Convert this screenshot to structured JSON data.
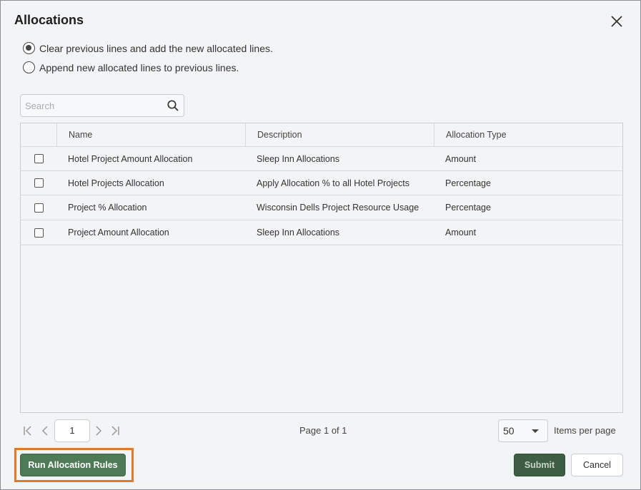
{
  "dialog": {
    "title": "Allocations",
    "close_icon": "close-icon"
  },
  "options": [
    {
      "label": "Clear previous lines and add the new allocated lines.",
      "selected": true
    },
    {
      "label": "Append new allocated lines to previous lines.",
      "selected": false
    }
  ],
  "search": {
    "placeholder": "Search",
    "value": "",
    "icon": "search-icon"
  },
  "table": {
    "columns": [
      "Name",
      "Description",
      "Allocation Type"
    ],
    "rows": [
      {
        "name": "Hotel Project Amount Allocation",
        "description": "Sleep Inn Allocations",
        "type": "Amount",
        "checked": false
      },
      {
        "name": "Hotel Projects Allocation",
        "description": "Apply Allocation % to all Hotel Projects",
        "type": "Percentage",
        "checked": false
      },
      {
        "name": "Project % Allocation",
        "description": "Wisconsin Dells Project Resource Usage",
        "type": "Percentage",
        "checked": false
      },
      {
        "name": "Project Amount Allocation",
        "description": "Sleep Inn Allocations",
        "type": "Amount",
        "checked": false
      }
    ]
  },
  "pager": {
    "current_page": "1",
    "page_info": "Page 1 of 1",
    "per_page": "50",
    "per_page_label": "Items per page"
  },
  "actions": {
    "run_label": "Run Allocation Rules",
    "submit_label": "Submit",
    "cancel_label": "Cancel"
  },
  "colors": {
    "run_button": "#4e7a56",
    "submit_button": "#3d5e43",
    "highlight_outline": "#e07a2c"
  }
}
